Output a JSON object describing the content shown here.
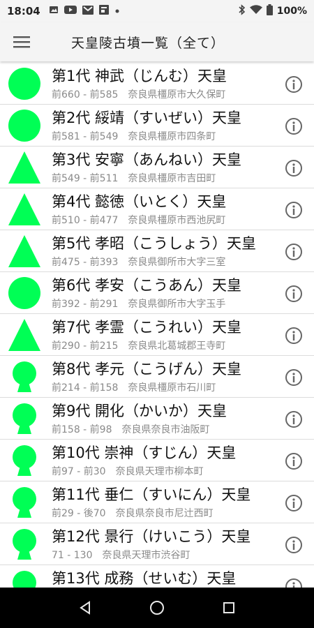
{
  "status_bar": {
    "time": "18:04",
    "battery": "100%",
    "icons_left": [
      "image-icon",
      "youtube-icon",
      "gmail-icon",
      "news-icon",
      "dot-icon"
    ],
    "icons_right": [
      "bluetooth-icon",
      "wifi-icon",
      "battery-icon"
    ]
  },
  "app_bar": {
    "title": "天皇陵古墳一覧（全て）",
    "menu_icon": "hamburger-menu-icon"
  },
  "colors": {
    "shape_fill": "#00ff55",
    "info_icon": "#666666",
    "subtitle": "#8a8a8a"
  },
  "emperors": [
    {
      "title": "第1代 神武（じんむ）天皇",
      "period": "前660 - 前585",
      "location": "奈良県橿原市大久保町",
      "shape": "circle"
    },
    {
      "title": "第2代 綏靖（すいぜい）天皇",
      "period": "前581 - 前549",
      "location": "奈良県橿原市四条町",
      "shape": "circle"
    },
    {
      "title": "第3代 安寧（あんねい）天皇",
      "period": "前549 - 前511",
      "location": "奈良県橿原市吉田町",
      "shape": "triangle"
    },
    {
      "title": "第4代 懿徳（いとく）天皇",
      "period": "前510 - 前477",
      "location": "奈良県橿原市西池尻町",
      "shape": "triangle"
    },
    {
      "title": "第5代 孝昭（こうしょう）天皇",
      "period": "前475 - 前393",
      "location": "奈良県御所市大字三室",
      "shape": "triangle"
    },
    {
      "title": "第6代 孝安（こうあん）天皇",
      "period": "前392 - 前291",
      "location": "奈良県御所市大字玉手",
      "shape": "circle"
    },
    {
      "title": "第7代 孝霊（こうれい）天皇",
      "period": "前290 - 前215",
      "location": "奈良県北葛城郡王寺町",
      "shape": "triangle"
    },
    {
      "title": "第8代 孝元（こうげん）天皇",
      "period": "前214 - 前158",
      "location": "奈良県橿原市石川町",
      "shape": "keyhole"
    },
    {
      "title": "第9代 開化（かいか）天皇",
      "period": "前158 - 前98",
      "location": "奈良県奈良市油阪町",
      "shape": "keyhole"
    },
    {
      "title": "第10代 崇神（すじん）天皇",
      "period": "前97 - 前30",
      "location": "奈良県天理市柳本町",
      "shape": "keyhole"
    },
    {
      "title": "第11代 垂仁（すいにん）天皇",
      "period": "前29 - 後70",
      "location": "奈良県奈良市尼辻西町",
      "shape": "keyhole"
    },
    {
      "title": "第12代 景行（けいこう）天皇",
      "period": "71 - 130",
      "location": "奈良県天理市渋谷町",
      "shape": "keyhole"
    },
    {
      "title": "第13代 成務（せいむ）天皇",
      "period": "",
      "location": "",
      "shape": "keyhole"
    }
  ],
  "nav_bar": {
    "buttons": [
      "back-triangle-icon",
      "home-circle-icon",
      "recents-square-icon"
    ]
  }
}
